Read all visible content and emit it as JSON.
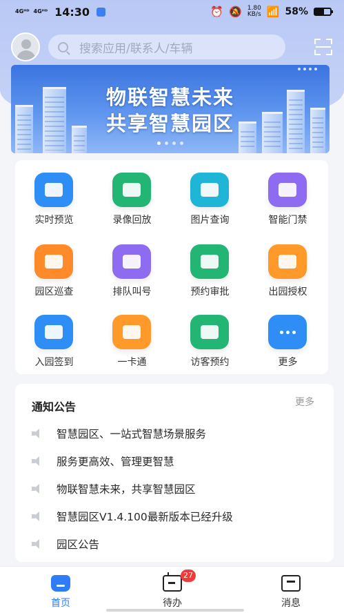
{
  "status_bar": {
    "signal1": "4Gᴴᴰ",
    "signal2": "4Gᴴᴰ",
    "time": "14:30",
    "net_speed_value": "1.80",
    "net_speed_unit": "KB/s",
    "battery": "58%",
    "battery_level": 0.58
  },
  "header": {
    "search_placeholder": "搜索应用/联系人/车辆"
  },
  "banner": {
    "title_line1": "物联智慧未来",
    "title_line2": "共享智慧园区"
  },
  "apps": [
    {
      "label": "实时预览",
      "icon": "video-camera-icon",
      "color": "#2f8ef5"
    },
    {
      "label": "录像回放",
      "icon": "playback-icon",
      "color": "#22b573"
    },
    {
      "label": "图片查询",
      "icon": "image-icon",
      "color": "#1fb5d6"
    },
    {
      "label": "智能门禁",
      "icon": "door-icon",
      "color": "#8e6cf2"
    },
    {
      "label": "园区巡查",
      "icon": "patrol-icon",
      "color": "#ff8a2a"
    },
    {
      "label": "排队叫号",
      "icon": "queue-icon",
      "color": "#8e6cf2"
    },
    {
      "label": "预约审批",
      "icon": "approval-icon",
      "color": "#22b573"
    },
    {
      "label": "出园授权",
      "icon": "authorize-icon",
      "color": "#ff9a2a"
    },
    {
      "label": "入园签到",
      "icon": "sign-in-icon",
      "color": "#2f8ef5"
    },
    {
      "label": "一卡通",
      "icon": "card-icon",
      "color": "#ff9a2a"
    },
    {
      "label": "访客预约",
      "icon": "visitor-icon",
      "color": "#22b573"
    },
    {
      "label": "更多",
      "icon": "more-icon",
      "color": "#2f8ef5"
    }
  ],
  "notices": {
    "title": "通知公告",
    "more": "更多",
    "items": [
      "智慧园区、一站式智慧场景服务",
      "服务更高效、管理更智慧",
      "物联智慧未来，共享智慧园区",
      "智慧园区V1.4.100最新版本已经升级",
      "园区公告"
    ]
  },
  "tabbar": {
    "tabs": [
      {
        "label": "首页",
        "icon": "home-icon",
        "active": true
      },
      {
        "label": "待办",
        "icon": "todo-icon",
        "badge": "27"
      },
      {
        "label": "消息",
        "icon": "message-icon"
      }
    ]
  }
}
